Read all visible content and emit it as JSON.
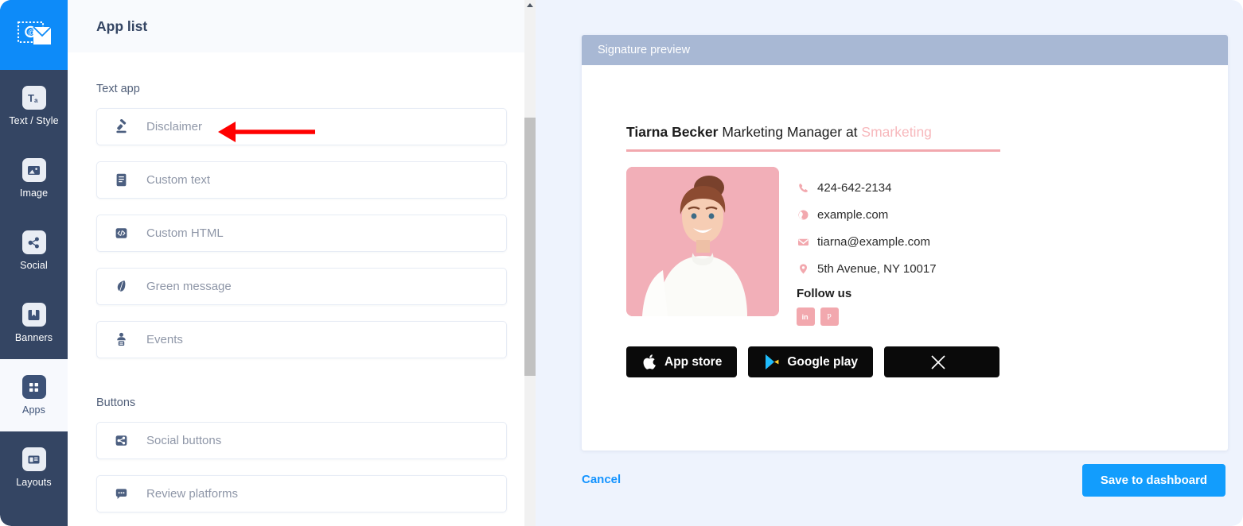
{
  "colors": {
    "rail_bg": "#344563",
    "logo_bg": "#0d8bf9",
    "accent_blue": "#129dfd",
    "preview_header": "#a8b8d4",
    "pane_bg": "#eef3fd",
    "signature_pink": "#f2a8ae",
    "company_pink": "#f7b8bc",
    "annotation_red": "#ff0000"
  },
  "rail": {
    "logo_icon": "stamped-envelope-at-logo",
    "items": [
      {
        "label": "Text / Style",
        "icon": "text-style-icon",
        "active": false
      },
      {
        "label": "Image",
        "icon": "image-icon",
        "active": false
      },
      {
        "label": "Social",
        "icon": "share-nodes-icon",
        "active": false
      },
      {
        "label": "Banners",
        "icon": "bookmark-icon",
        "active": false
      },
      {
        "label": "Apps",
        "icon": "grid-apps-icon",
        "active": true
      },
      {
        "label": "Layouts",
        "icon": "layouts-icon",
        "active": false
      }
    ]
  },
  "app_list": {
    "header_title": "App list",
    "groups": [
      {
        "label": "Text app",
        "items": [
          {
            "label": "Disclaimer",
            "icon": "gavel-icon"
          },
          {
            "label": "Custom text",
            "icon": "document-lines-icon"
          },
          {
            "label": "Custom HTML",
            "icon": "code-brackets-icon"
          },
          {
            "label": "Green message",
            "icon": "leaf-icon"
          },
          {
            "label": "Events",
            "icon": "podium-speaker-icon"
          }
        ]
      },
      {
        "label": "Buttons",
        "items": [
          {
            "label": "Social buttons",
            "icon": "share-nodes-icon"
          },
          {
            "label": "Review platforms",
            "icon": "comment-dots-icon"
          }
        ]
      }
    ],
    "scrollbar": {
      "up_arrow_icon": "caret-up-icon",
      "thumb_visible": true
    }
  },
  "preview": {
    "header_title": "Signature preview",
    "signature": {
      "name": "Tiarna Becker",
      "title": " Marketing Manager at ",
      "company": "Smarketing",
      "photo_alt": "smiling-woman-portrait-pink-background",
      "details": [
        {
          "icon": "phone-icon",
          "value": "424-642-2134"
        },
        {
          "icon": "globe-icon",
          "value": "example.com"
        },
        {
          "icon": "envelope-icon",
          "value": "tiarna@example.com"
        },
        {
          "icon": "location-pin-icon",
          "value": "5th Avenue, NY 10017"
        }
      ],
      "follow_label": "Follow us",
      "social_icons": [
        {
          "name": "linkedin-icon",
          "glyph": "in"
        },
        {
          "name": "pinterest-icon",
          "glyph": "P"
        }
      ],
      "store_buttons": [
        {
          "label": "App store",
          "icon": "apple-icon"
        },
        {
          "label": "Google play",
          "icon": "google-play-icon"
        },
        {
          "label": "",
          "icon": "x-twitter-icon"
        }
      ]
    }
  },
  "footer": {
    "cancel_label": "Cancel",
    "save_label": "Save to dashboard"
  },
  "annotation": {
    "arrow": "left-pointing-arrow-to-disclaimer"
  }
}
